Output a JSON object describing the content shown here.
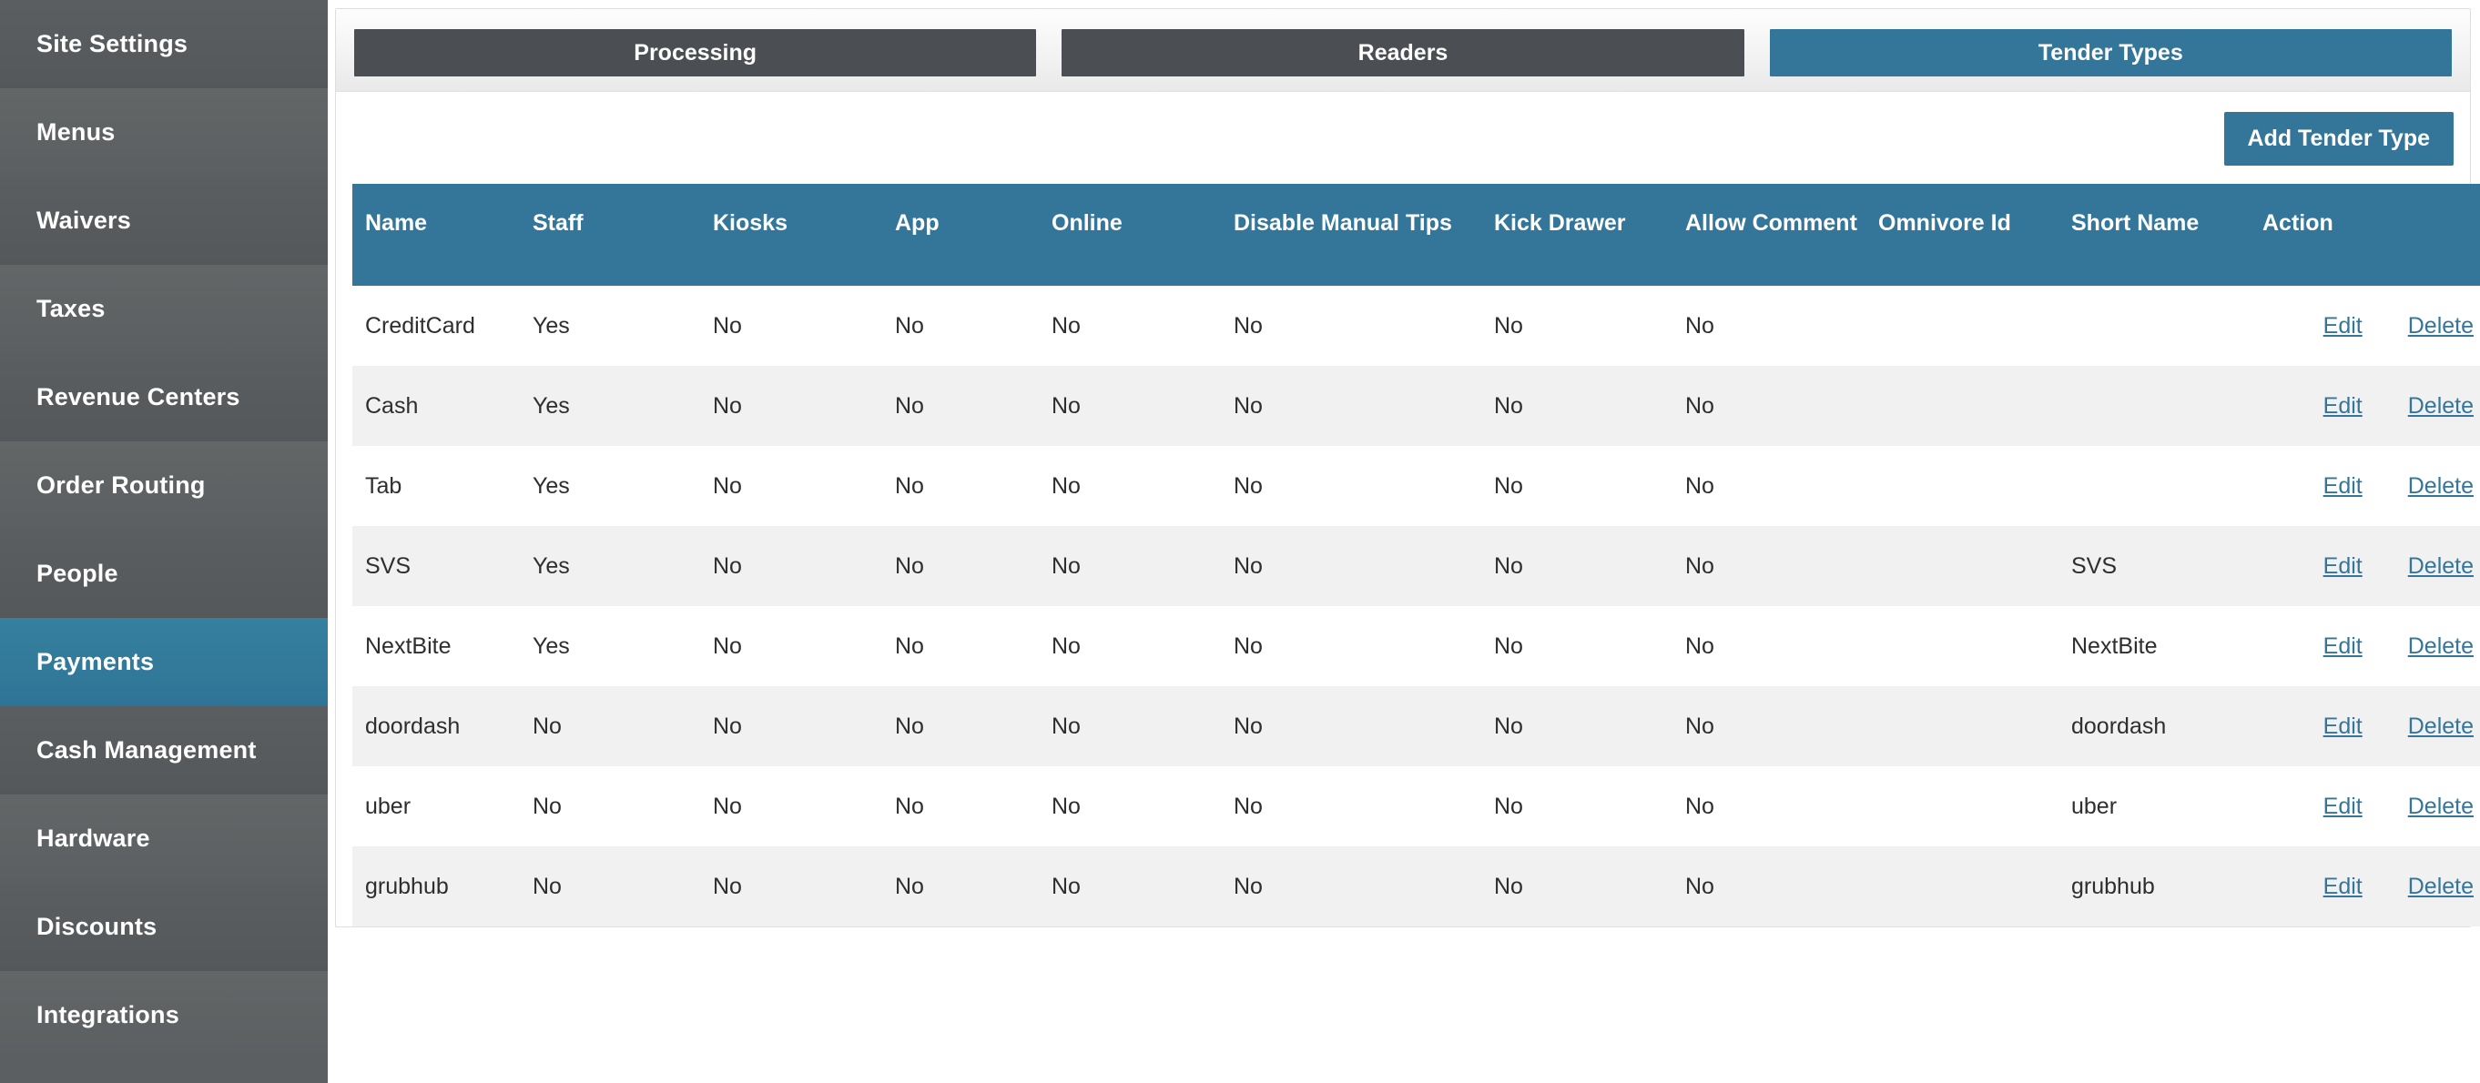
{
  "sidebar": {
    "items": [
      {
        "label": "Site Settings",
        "active": false
      },
      {
        "label": "Menus",
        "active": false
      },
      {
        "label": "Waivers",
        "active": false
      },
      {
        "label": "Taxes",
        "active": false
      },
      {
        "label": "Revenue Centers",
        "active": false
      },
      {
        "label": "Order Routing",
        "active": false
      },
      {
        "label": "People",
        "active": false
      },
      {
        "label": "Payments",
        "active": true
      },
      {
        "label": "Cash Management",
        "active": false
      },
      {
        "label": "Hardware",
        "active": false
      },
      {
        "label": "Discounts",
        "active": false
      },
      {
        "label": "Integrations",
        "active": false
      }
    ]
  },
  "tabs": [
    {
      "label": "Processing",
      "active": false
    },
    {
      "label": "Readers",
      "active": false
    },
    {
      "label": "Tender Types",
      "active": true
    }
  ],
  "toolbar": {
    "add_tender_type_label": "Add Tender Type"
  },
  "table": {
    "columns": [
      "Name",
      "Staff",
      "Kiosks",
      "App",
      "Online",
      "Disable Manual Tips",
      "Kick Drawer",
      "Allow Comment",
      "Omnivore Id",
      "Short Name",
      "Action"
    ],
    "row_actions": {
      "edit_label": "Edit",
      "delete_label": "Delete"
    },
    "rows": [
      {
        "name": "CreditCard",
        "staff": "Yes",
        "kiosks": "No",
        "app": "No",
        "online": "No",
        "disable_manual_tips": "No",
        "kick_drawer": "No",
        "allow_comment": "No",
        "omnivore_id": "",
        "short_name": ""
      },
      {
        "name": "Cash",
        "staff": "Yes",
        "kiosks": "No",
        "app": "No",
        "online": "No",
        "disable_manual_tips": "No",
        "kick_drawer": "No",
        "allow_comment": "No",
        "omnivore_id": "",
        "short_name": ""
      },
      {
        "name": "Tab",
        "staff": "Yes",
        "kiosks": "No",
        "app": "No",
        "online": "No",
        "disable_manual_tips": "No",
        "kick_drawer": "No",
        "allow_comment": "No",
        "omnivore_id": "",
        "short_name": ""
      },
      {
        "name": "SVS",
        "staff": "Yes",
        "kiosks": "No",
        "app": "No",
        "online": "No",
        "disable_manual_tips": "No",
        "kick_drawer": "No",
        "allow_comment": "No",
        "omnivore_id": "",
        "short_name": "SVS"
      },
      {
        "name": "NextBite",
        "staff": "Yes",
        "kiosks": "No",
        "app": "No",
        "online": "No",
        "disable_manual_tips": "No",
        "kick_drawer": "No",
        "allow_comment": "No",
        "omnivore_id": "",
        "short_name": "NextBite"
      },
      {
        "name": "doordash",
        "staff": "No",
        "kiosks": "No",
        "app": "No",
        "online": "No",
        "disable_manual_tips": "No",
        "kick_drawer": "No",
        "allow_comment": "No",
        "omnivore_id": "",
        "short_name": "doordash"
      },
      {
        "name": "uber",
        "staff": "No",
        "kiosks": "No",
        "app": "No",
        "online": "No",
        "disable_manual_tips": "No",
        "kick_drawer": "No",
        "allow_comment": "No",
        "omnivore_id": "",
        "short_name": "uber"
      },
      {
        "name": "grubhub",
        "staff": "No",
        "kiosks": "No",
        "app": "No",
        "online": "No",
        "disable_manual_tips": "No",
        "kick_drawer": "No",
        "allow_comment": "No",
        "omnivore_id": "",
        "short_name": "grubhub"
      }
    ]
  },
  "colors": {
    "accent_blue": "#34769a",
    "sidebar_gray": "#5c5f61",
    "tab_inactive_gray": "#4b4f53",
    "row_alt": "#f1f1f1",
    "link_blue": "#34769a"
  }
}
